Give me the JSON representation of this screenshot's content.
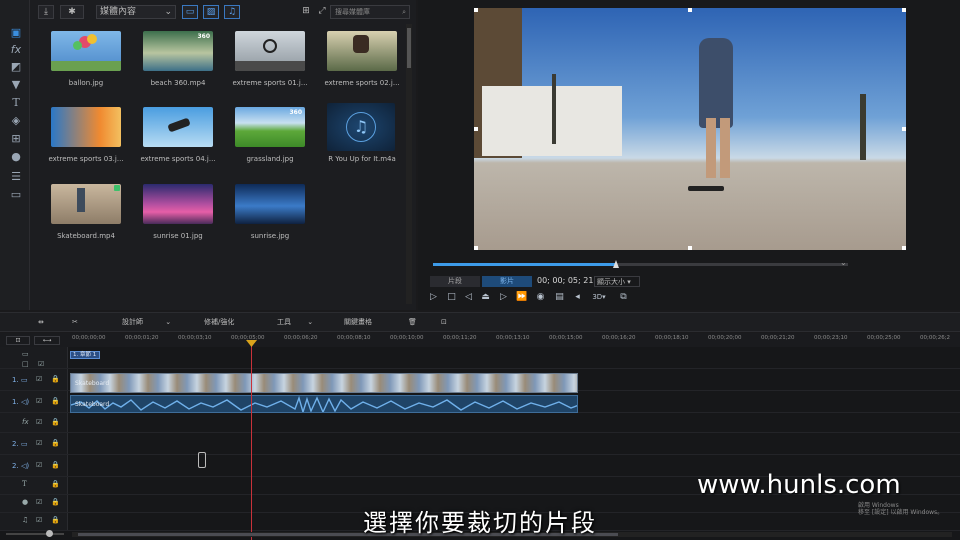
{
  "left_tools": [
    {
      "icon": "media-room-icon",
      "label": ""
    },
    {
      "icon": "fx-icon",
      "label": "fx"
    },
    {
      "icon": "pip-icon",
      "label": ""
    },
    {
      "icon": "particle-icon",
      "label": ""
    },
    {
      "icon": "title-icon",
      "label": "T"
    },
    {
      "icon": "transition-icon",
      "label": ""
    },
    {
      "icon": "audio-mix-icon",
      "label": ""
    },
    {
      "icon": "voiceover-icon",
      "label": ""
    },
    {
      "icon": "chapter-icon",
      "label": ""
    },
    {
      "icon": "subtitle-icon",
      "label": ""
    }
  ],
  "library": {
    "dropdown": "媒體內容",
    "search_placeholder": "搜尋媒體庫",
    "items": [
      {
        "name": "ballon.jpg",
        "badge": ""
      },
      {
        "name": "beach 360.mp4",
        "badge": "360"
      },
      {
        "name": "extreme sports 01.j...",
        "badge": ""
      },
      {
        "name": "extreme sports 02.j...",
        "badge": ""
      },
      {
        "name": "extreme sports 03.j...",
        "badge": ""
      },
      {
        "name": "extreme sports 04.j...",
        "badge": ""
      },
      {
        "name": "grassland.jpg",
        "badge": "360"
      },
      {
        "name": "R You Up for It.m4a",
        "badge": ""
      },
      {
        "name": "Skateboard.mp4",
        "badge": ""
      },
      {
        "name": "sunrise 01.jpg",
        "badge": ""
      },
      {
        "name": "sunrise.jpg",
        "badge": ""
      }
    ]
  },
  "preview": {
    "mode_clip": "片段",
    "mode_project": "影片",
    "timecode": "00; 00; 05; 21",
    "view_size": "顯示大小",
    "three_d": "3D",
    "scrub_progress": 0.44
  },
  "edit_toolbar": {
    "designer": "設計師",
    "fix_enhance": "修補/強化",
    "tools": "工具",
    "keyframe": "關鍵畫格"
  },
  "ruler": [
    "00;00;00;00",
    "00;00;01;20",
    "00;00;03;10",
    "00;00;05;00",
    "00;00;06;20",
    "00;00;08;10",
    "00;00;10;00",
    "00;00;11;20",
    "00;00;13;10",
    "00;00;15;00",
    "00;00;16;20",
    "00;00;18;10",
    "00;00;20;00",
    "00;00;21;20",
    "00;00;23;10",
    "00;00;25;00",
    "00;00;26;2"
  ],
  "timeline": {
    "chapter_label": "1. 章節 1",
    "track1": "1.",
    "track2": "2.",
    "fx_label": "fx",
    "title_label": "T",
    "video_clip": "Skateboard",
    "audio_clip": "Skateboard"
  },
  "subtitle": "選擇你要裁切的片段",
  "watermark": "www.hunls.com",
  "activate_text": "啟用 Windows",
  "activate_sub": "移至 [設定] 以啟用 Windows。",
  "colors": {
    "accent": "#3d9be9",
    "playhead": "#c8323a",
    "audio_clip": "#1f4467"
  }
}
